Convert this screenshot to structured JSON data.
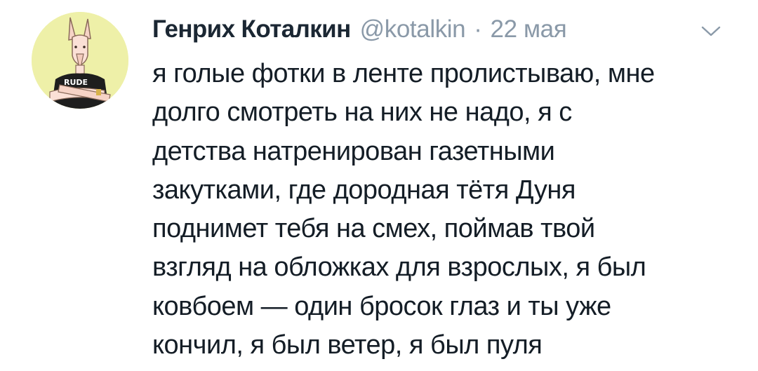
{
  "tweet": {
    "author_name": "Генрих Коталкин",
    "handle": "@kotalkin",
    "separator": "·",
    "date": "22 мая",
    "menu_icon": "chevron-down-icon",
    "avatar_badge": "RUDE",
    "text_lines": [
      "я голые фотки в ленте пролистываю, мне",
      "долго смотреть на них не надо, я с",
      "детства натренирован газетными",
      "закутками, где дородная тётя Дуня",
      "поднимет тебя на смех, поймав твой",
      "взгляд на обложках для взрослых, я был",
      "ковбоем — один бросок глаз и ты уже",
      "кончил, я был ветер, я был пуля"
    ]
  },
  "colors": {
    "name": "#1b2733",
    "meta": "#8a99a8",
    "text": "#141d26",
    "avatar_bg": "#eef0a8",
    "background": "#ffffff"
  }
}
